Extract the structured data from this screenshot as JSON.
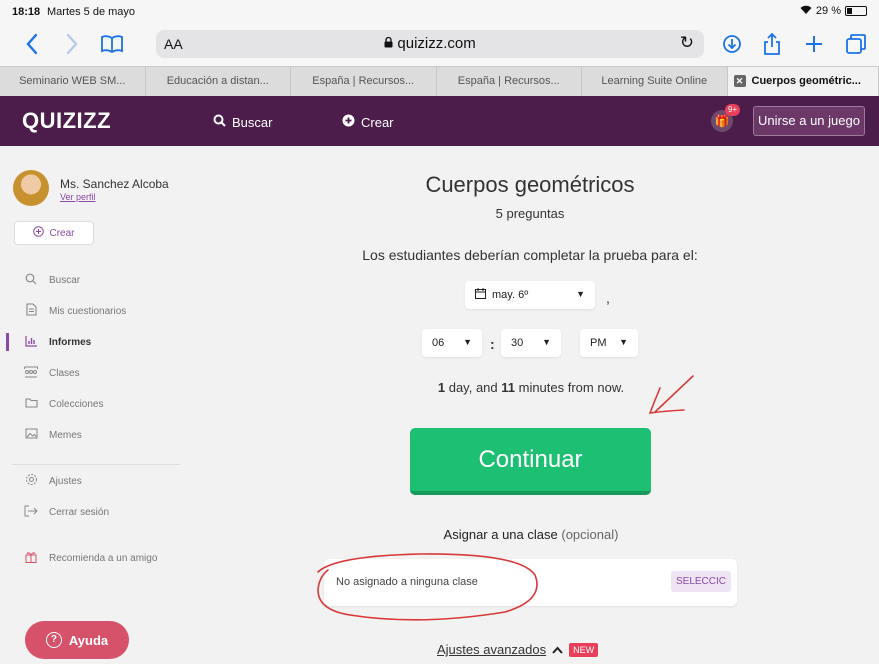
{
  "status_bar": {
    "time": "18:18",
    "date": "Martes 5 de mayo",
    "battery": "29 %",
    "battery_level": 0.29
  },
  "browser": {
    "reader_label": "AA",
    "url_host": "quizizz.com",
    "tabs": [
      {
        "label": "Seminario WEB SM..."
      },
      {
        "label": "Educación a distan..."
      },
      {
        "label": "España | Recursos..."
      },
      {
        "label": "España | Recursos..."
      },
      {
        "label": "Learning Suite Online"
      },
      {
        "label": "Cuerpos geométric...",
        "active": true
      }
    ]
  },
  "header": {
    "logo": "QUIZIZZ",
    "search_label": "Buscar",
    "create_label": "Crear",
    "gift_badge": "9+",
    "join_label": "Unirse a un juego",
    "bg_color": "#4c1d4a"
  },
  "sidebar": {
    "teacher_name": "Ms. Sanchez Alcoba",
    "profile_link": "Ver perfil",
    "create_label": "Crear",
    "items": [
      {
        "label": "Buscar",
        "icon": "search-icon"
      },
      {
        "label": "Mis cuestionarios",
        "icon": "document-icon"
      },
      {
        "label": "Informes",
        "icon": "bar-chart-icon",
        "active": true
      },
      {
        "label": "Clases",
        "icon": "users-icon"
      },
      {
        "label": "Colecciones",
        "icon": "folder-icon"
      },
      {
        "label": "Memes",
        "icon": "image-icon"
      }
    ],
    "settings_label": "Ajustes",
    "logout_label": "Cerrar sesión",
    "recommend_label": "Recomienda a un amigo"
  },
  "main": {
    "quiz_title": "Cuerpos geométricos",
    "question_count": "5 preguntas",
    "deadline_prompt": "Los estudiantes deberían completar la prueba para el:",
    "date_value": "may. 6º",
    "hour_value": "06",
    "time_separator": ":",
    "minute_value": "30",
    "ampm_value": "PM",
    "comma": ",",
    "countdown_days": "1",
    "countdown_days_text": " day, and ",
    "countdown_minutes": "11",
    "countdown_minutes_text": " minutes from now.",
    "continue_label": "Continuar",
    "assign_label": "Asignar a una clase",
    "assign_optional": "(opcional)",
    "class_placeholder": "No asignado a ninguna clase",
    "select_label": "SELECCIC",
    "advanced_label": "Ajustes avanzados",
    "new_badge": "NEW",
    "help_label": "Ayuda",
    "accent_color": "#1dbf73"
  }
}
